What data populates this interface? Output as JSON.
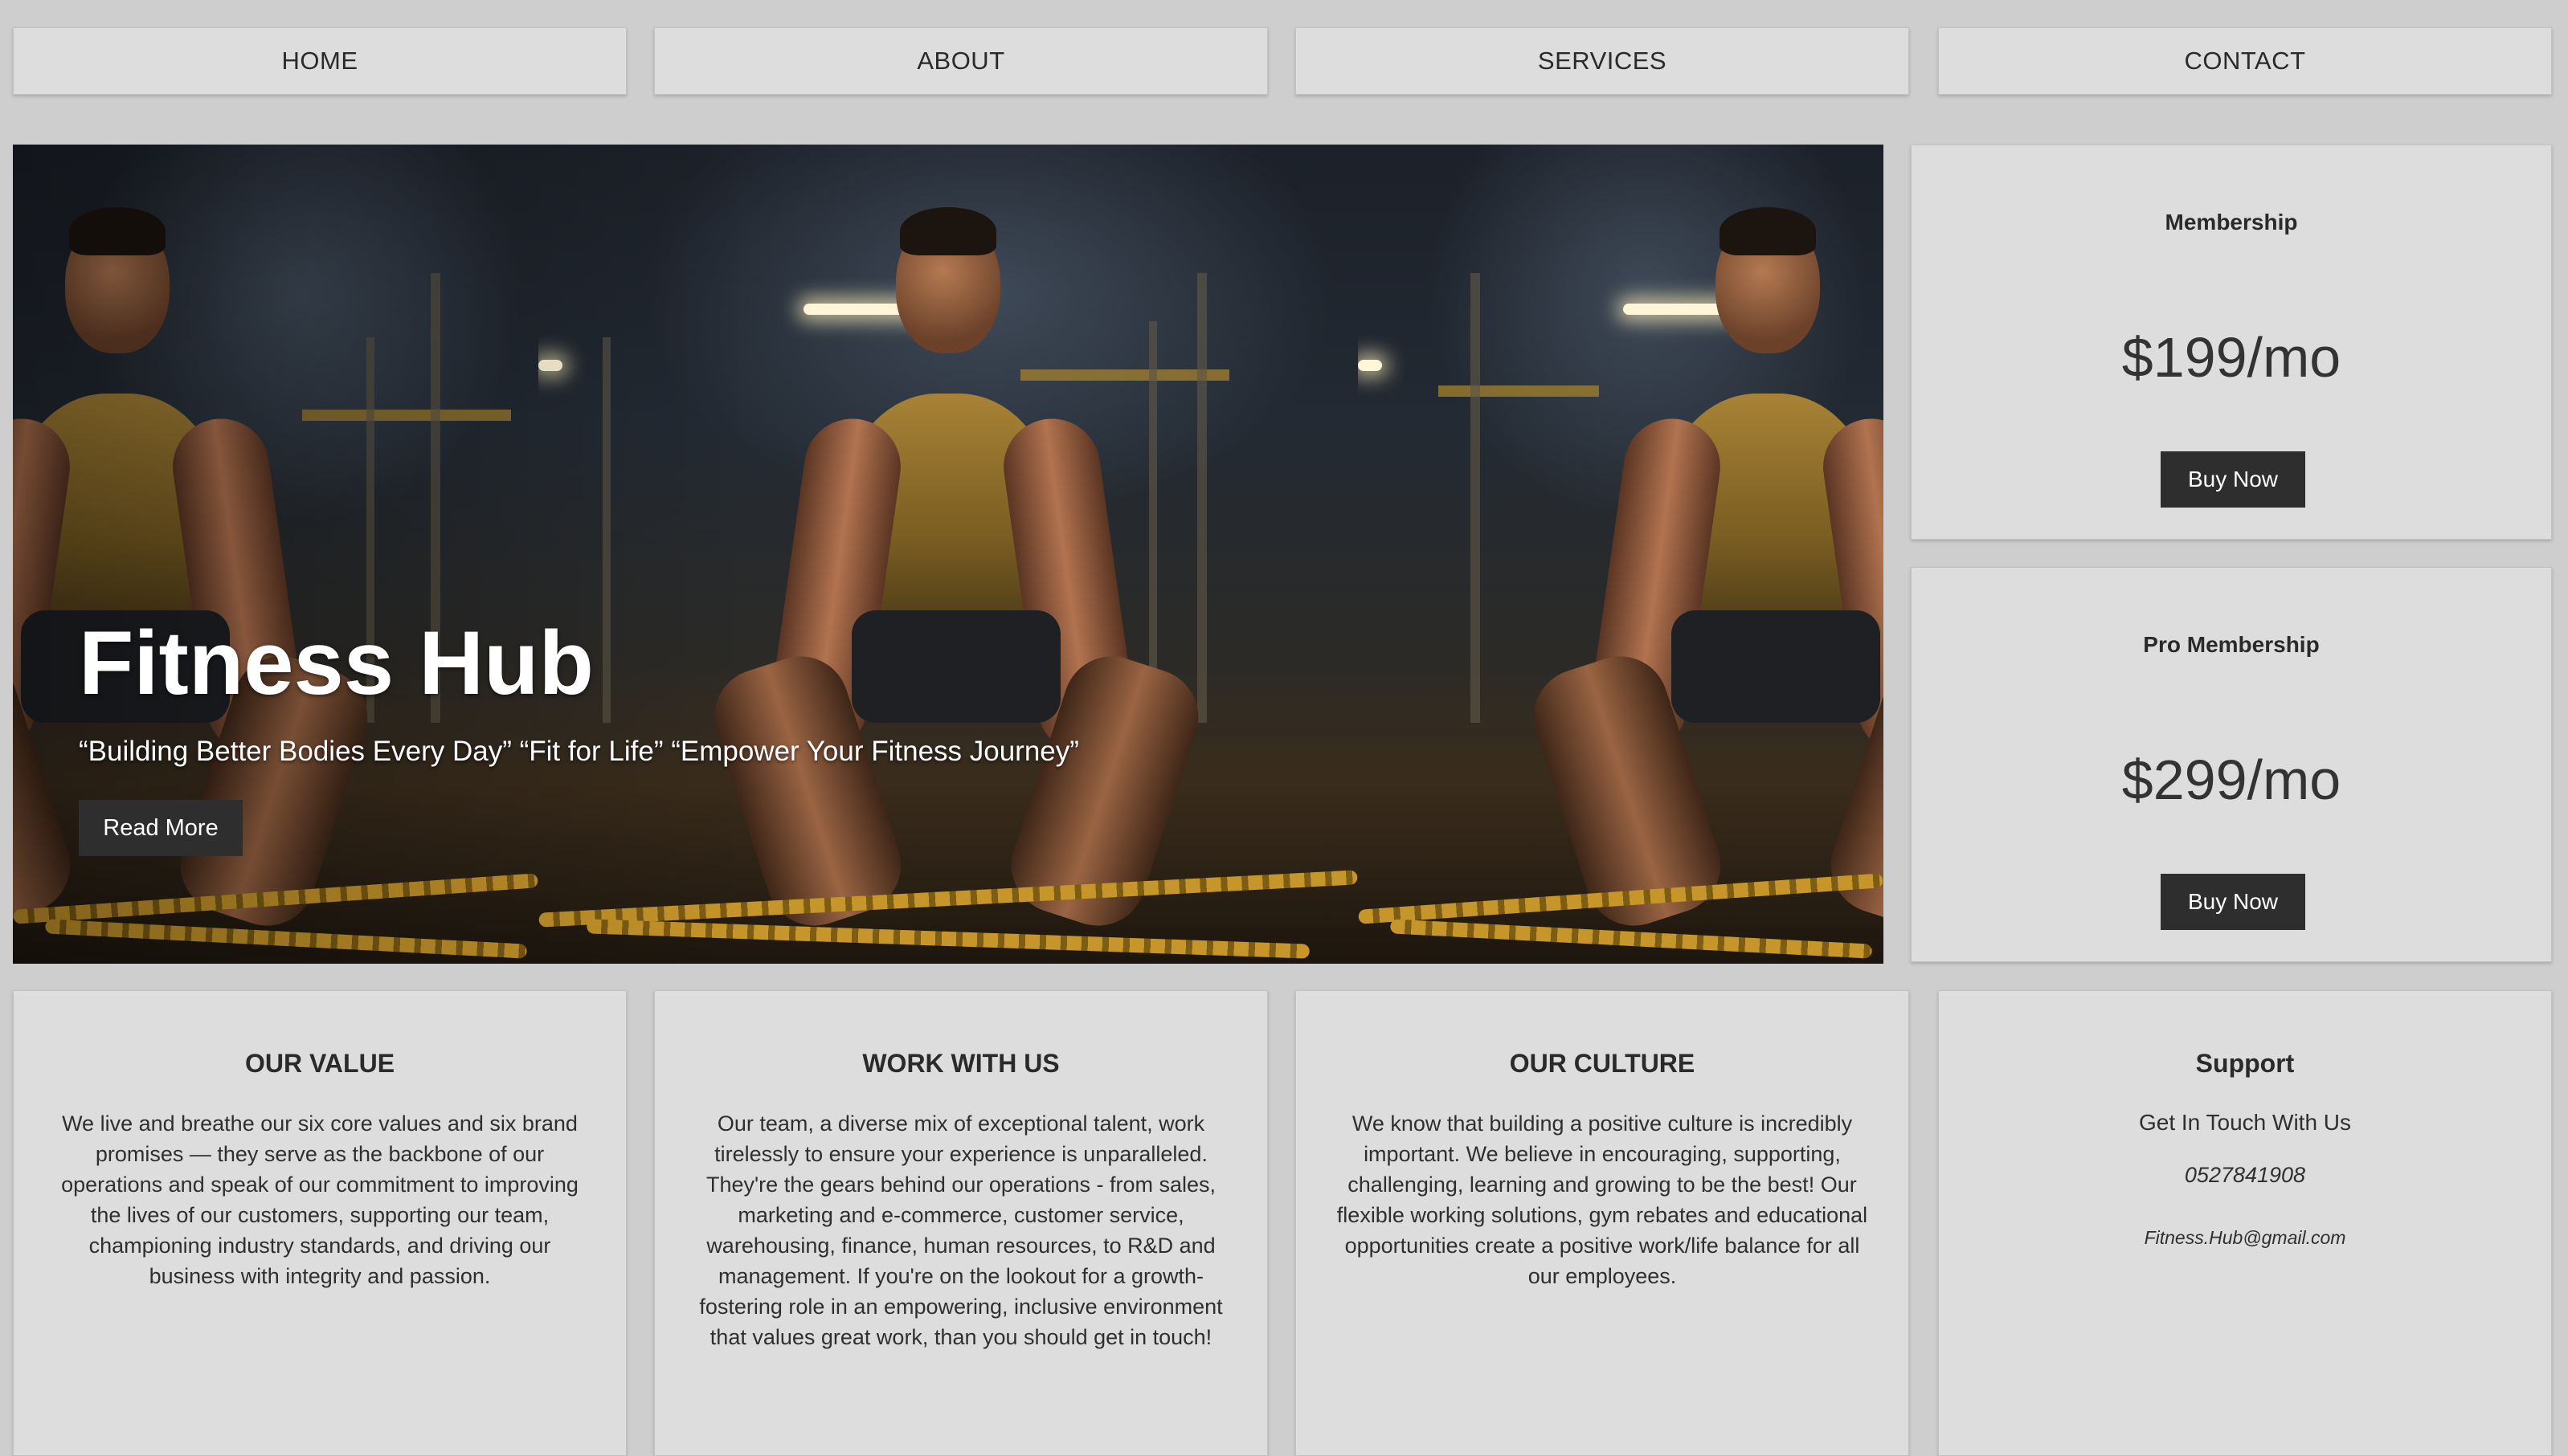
{
  "nav": {
    "items": [
      {
        "label": "HOME"
      },
      {
        "label": "ABOUT"
      },
      {
        "label": "SERVICES"
      },
      {
        "label": "CONTACT"
      }
    ]
  },
  "hero": {
    "title": "Fitness Hub",
    "tagline": "“Building Better Bodies Every Day” “Fit for Life” “Empower Your Fitness Journey”",
    "button_label": "Read More"
  },
  "pricing": [
    {
      "name": "Membership",
      "price": "$199/mo",
      "button_label": "Buy Now"
    },
    {
      "name": "Pro Membership",
      "price": "$299/mo",
      "button_label": "Buy Now"
    }
  ],
  "info": [
    {
      "title": "OUR VALUE",
      "body": "We live and breathe our six core values and six brand promises — they serve as the backbone of our operations and speak of our commitment to improving the lives of our customers, supporting our team, championing industry standards, and driving our business with integrity and passion."
    },
    {
      "title": "WORK WITH US",
      "body": "Our team, a diverse mix of exceptional talent, work tirelessly to ensure your experience is unparalleled. They're the gears behind our operations - from sales, marketing and e-commerce, customer service, warehousing, finance, human resources, to R&D and management. If you're on the lookout for a growth-fostering role in an empowering, inclusive environment that values great work, than you should get in touch!"
    },
    {
      "title": "OUR CULTURE",
      "body": "We know that building a positive culture is incredibly important. We believe in encouraging, supporting, challenging, learning and growing to be the best! Our flexible working solutions, gym rebates and educational opportunities create a positive work/life balance for all our employees."
    }
  ],
  "support": {
    "title": "Support",
    "subtitle": "Get In Touch With Us",
    "phone": "0527841908",
    "email": "Fitness.Hub@gmail.com"
  }
}
